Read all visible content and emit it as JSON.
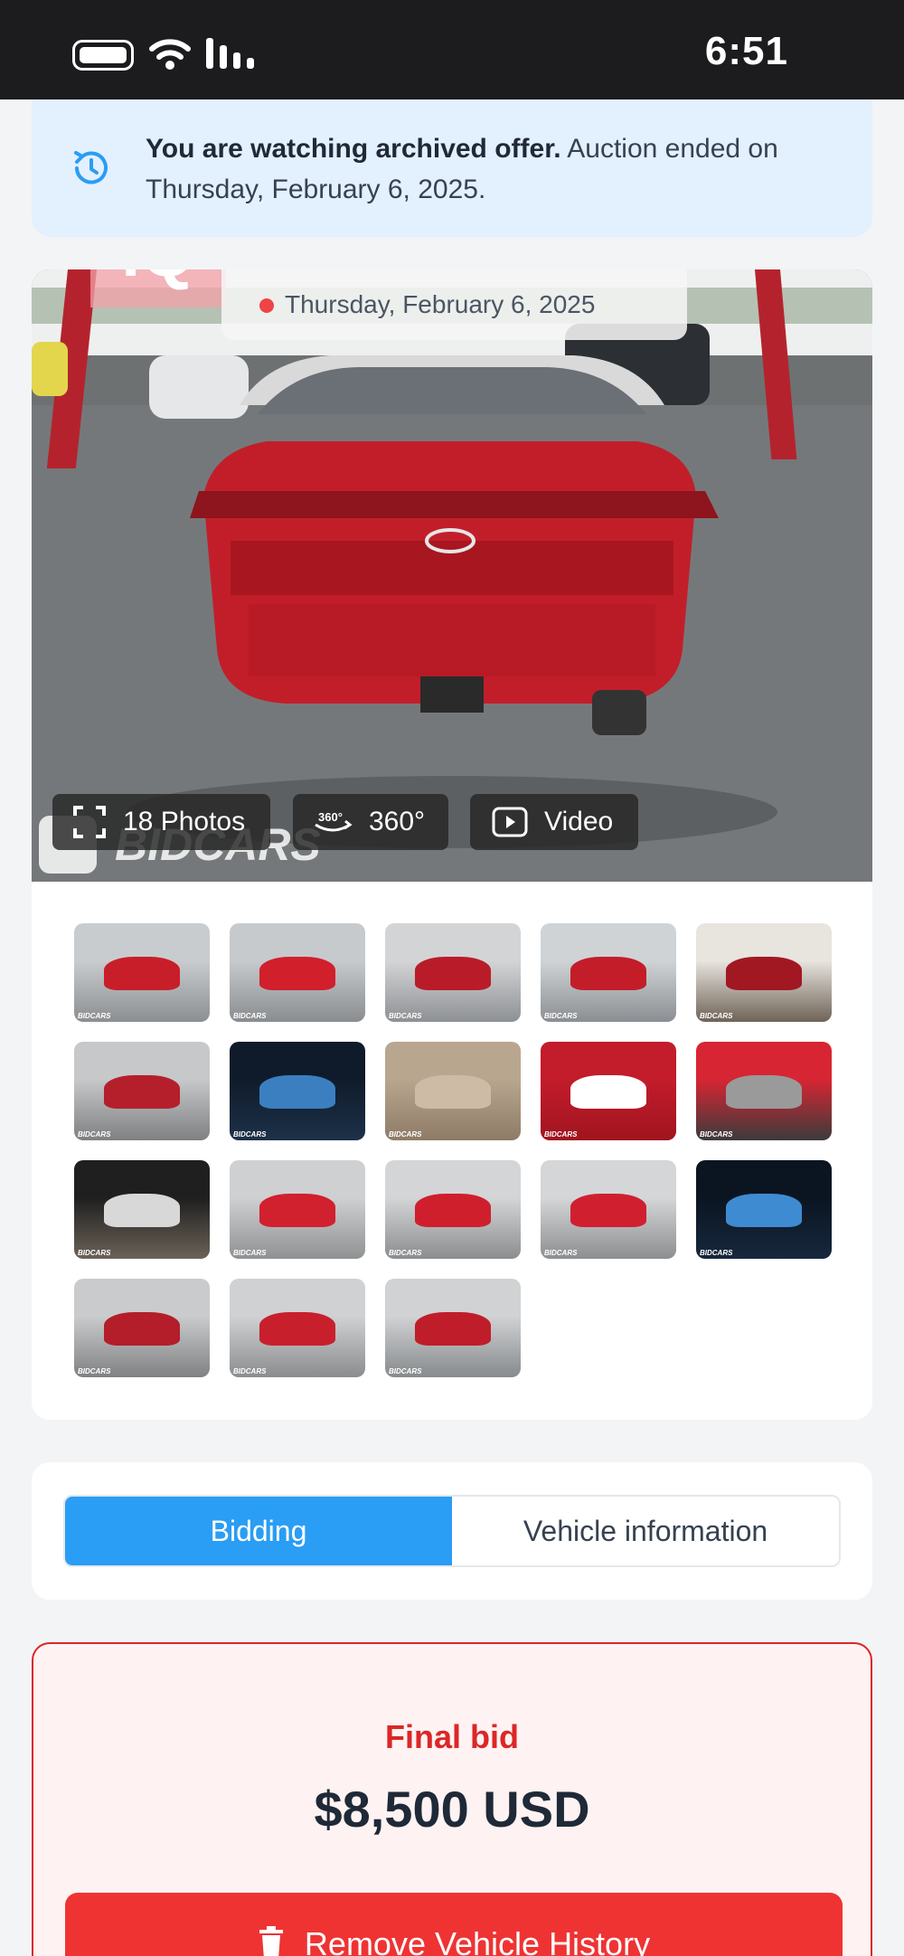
{
  "status_bar": {
    "time": "6:51"
  },
  "notice": {
    "bold_text": "You are watching archived offer.",
    "text": " Auction ended on Thursday, February 6, 2025."
  },
  "media": {
    "badge": "iQ",
    "auction_date": "Thursday, February 6, 2025",
    "photos_label": "18 Photos",
    "three_sixty_label": "360°",
    "video_label": "Video",
    "watermark": "BIDCARS",
    "thumbnails": [
      {
        "mark": "BIDCARS",
        "colors": [
          "#c9ccce",
          "#8c8f91",
          "#c81e2a"
        ]
      },
      {
        "mark": "BIDCARS",
        "colors": [
          "#c7cacc",
          "#8a8d90",
          "#d11f2c"
        ]
      },
      {
        "mark": "BIDCARS",
        "colors": [
          "#d2d4d6",
          "#8e9194",
          "#b91c28"
        ]
      },
      {
        "mark": "BIDCARS",
        "colors": [
          "#cfd3d6",
          "#8b8f93",
          "#c41d2a"
        ]
      },
      {
        "mark": "BIDCARS",
        "colors": [
          "#e8e4de",
          "#6f6357",
          "#a11823"
        ]
      },
      {
        "mark": "BIDCARS",
        "colors": [
          "#c6c8ca",
          "#7e8082",
          "#b51f2b"
        ]
      },
      {
        "mark": "BIDCARS",
        "colors": [
          "#0f1b2a",
          "#1d3149",
          "#3b7fc1"
        ]
      },
      {
        "mark": "BIDCARS",
        "colors": [
          "#b9a68f",
          "#8e7b66",
          "#cdbba5"
        ]
      },
      {
        "mark": "BIDCARS",
        "colors": [
          "#c31c2b",
          "#a0141f",
          "#ffffff"
        ]
      },
      {
        "mark": "BIDCARS",
        "colors": [
          "#d72533",
          "#3b3b3b",
          "#9a9a9a"
        ]
      },
      {
        "mark": "BIDCARS",
        "colors": [
          "#1f1f1f",
          "#6b6258",
          "#d8d8d8"
        ]
      },
      {
        "mark": "BIDCARS",
        "colors": [
          "#cfd0d1",
          "#8f9193",
          "#d1202e"
        ]
      },
      {
        "mark": "BIDCARS",
        "colors": [
          "#d3d5d7",
          "#8b8d8f",
          "#cf1f2d"
        ]
      },
      {
        "mark": "BIDCARS",
        "colors": [
          "#d4d6d8",
          "#8c8e90",
          "#d02030"
        ]
      },
      {
        "mark": "BIDCARS",
        "colors": [
          "#0b1522",
          "#16283d",
          "#3f8bd1"
        ]
      },
      {
        "mark": "BIDCARS",
        "colors": [
          "#cacbcc",
          "#7f8183",
          "#b31e2a"
        ]
      },
      {
        "mark": "BIDCARS",
        "colors": [
          "#cfd1d3",
          "#8a8c8e",
          "#c81f2c"
        ]
      },
      {
        "mark": "BIDCARS",
        "colors": [
          "#d0d2d4",
          "#878a8c",
          "#c01d2a"
        ]
      }
    ]
  },
  "tabs": [
    {
      "label": "Bidding",
      "active": true
    },
    {
      "label": "Vehicle information",
      "active": false
    }
  ],
  "bid": {
    "label": "Final bid",
    "amount": "$8,500 USD",
    "remove_button": "Remove Vehicle History"
  },
  "colors": {
    "accent_blue": "#2a9df4",
    "danger_red": "#ef3333",
    "notice_bg": "#e3f0fd"
  }
}
